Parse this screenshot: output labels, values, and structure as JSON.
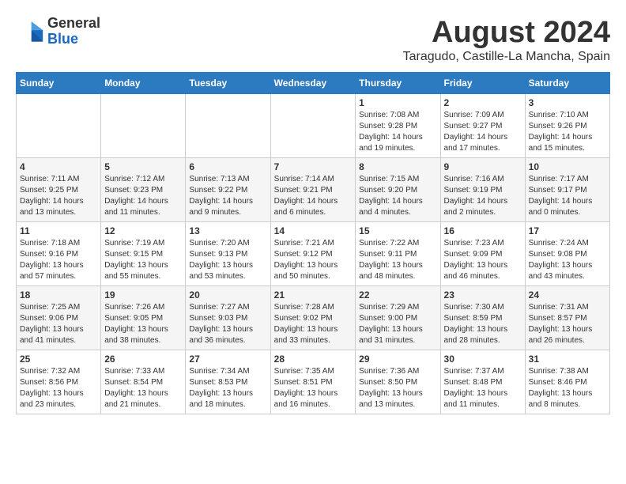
{
  "header": {
    "logo_general": "General",
    "logo_blue": "Blue",
    "main_title": "August 2024",
    "subtitle": "Taragudo, Castille-La Mancha, Spain"
  },
  "calendar": {
    "days_of_week": [
      "Sunday",
      "Monday",
      "Tuesday",
      "Wednesday",
      "Thursday",
      "Friday",
      "Saturday"
    ],
    "weeks": [
      [
        {
          "day": "",
          "info": ""
        },
        {
          "day": "",
          "info": ""
        },
        {
          "day": "",
          "info": ""
        },
        {
          "day": "",
          "info": ""
        },
        {
          "day": "1",
          "info": "Sunrise: 7:08 AM\nSunset: 9:28 PM\nDaylight: 14 hours\nand 19 minutes."
        },
        {
          "day": "2",
          "info": "Sunrise: 7:09 AM\nSunset: 9:27 PM\nDaylight: 14 hours\nand 17 minutes."
        },
        {
          "day": "3",
          "info": "Sunrise: 7:10 AM\nSunset: 9:26 PM\nDaylight: 14 hours\nand 15 minutes."
        }
      ],
      [
        {
          "day": "4",
          "info": "Sunrise: 7:11 AM\nSunset: 9:25 PM\nDaylight: 14 hours\nand 13 minutes."
        },
        {
          "day": "5",
          "info": "Sunrise: 7:12 AM\nSunset: 9:23 PM\nDaylight: 14 hours\nand 11 minutes."
        },
        {
          "day": "6",
          "info": "Sunrise: 7:13 AM\nSunset: 9:22 PM\nDaylight: 14 hours\nand 9 minutes."
        },
        {
          "day": "7",
          "info": "Sunrise: 7:14 AM\nSunset: 9:21 PM\nDaylight: 14 hours\nand 6 minutes."
        },
        {
          "day": "8",
          "info": "Sunrise: 7:15 AM\nSunset: 9:20 PM\nDaylight: 14 hours\nand 4 minutes."
        },
        {
          "day": "9",
          "info": "Sunrise: 7:16 AM\nSunset: 9:19 PM\nDaylight: 14 hours\nand 2 minutes."
        },
        {
          "day": "10",
          "info": "Sunrise: 7:17 AM\nSunset: 9:17 PM\nDaylight: 14 hours\nand 0 minutes."
        }
      ],
      [
        {
          "day": "11",
          "info": "Sunrise: 7:18 AM\nSunset: 9:16 PM\nDaylight: 13 hours\nand 57 minutes."
        },
        {
          "day": "12",
          "info": "Sunrise: 7:19 AM\nSunset: 9:15 PM\nDaylight: 13 hours\nand 55 minutes."
        },
        {
          "day": "13",
          "info": "Sunrise: 7:20 AM\nSunset: 9:13 PM\nDaylight: 13 hours\nand 53 minutes."
        },
        {
          "day": "14",
          "info": "Sunrise: 7:21 AM\nSunset: 9:12 PM\nDaylight: 13 hours\nand 50 minutes."
        },
        {
          "day": "15",
          "info": "Sunrise: 7:22 AM\nSunset: 9:11 PM\nDaylight: 13 hours\nand 48 minutes."
        },
        {
          "day": "16",
          "info": "Sunrise: 7:23 AM\nSunset: 9:09 PM\nDaylight: 13 hours\nand 46 minutes."
        },
        {
          "day": "17",
          "info": "Sunrise: 7:24 AM\nSunset: 9:08 PM\nDaylight: 13 hours\nand 43 minutes."
        }
      ],
      [
        {
          "day": "18",
          "info": "Sunrise: 7:25 AM\nSunset: 9:06 PM\nDaylight: 13 hours\nand 41 minutes."
        },
        {
          "day": "19",
          "info": "Sunrise: 7:26 AM\nSunset: 9:05 PM\nDaylight: 13 hours\nand 38 minutes."
        },
        {
          "day": "20",
          "info": "Sunrise: 7:27 AM\nSunset: 9:03 PM\nDaylight: 13 hours\nand 36 minutes."
        },
        {
          "day": "21",
          "info": "Sunrise: 7:28 AM\nSunset: 9:02 PM\nDaylight: 13 hours\nand 33 minutes."
        },
        {
          "day": "22",
          "info": "Sunrise: 7:29 AM\nSunset: 9:00 PM\nDaylight: 13 hours\nand 31 minutes."
        },
        {
          "day": "23",
          "info": "Sunrise: 7:30 AM\nSunset: 8:59 PM\nDaylight: 13 hours\nand 28 minutes."
        },
        {
          "day": "24",
          "info": "Sunrise: 7:31 AM\nSunset: 8:57 PM\nDaylight: 13 hours\nand 26 minutes."
        }
      ],
      [
        {
          "day": "25",
          "info": "Sunrise: 7:32 AM\nSunset: 8:56 PM\nDaylight: 13 hours\nand 23 minutes."
        },
        {
          "day": "26",
          "info": "Sunrise: 7:33 AM\nSunset: 8:54 PM\nDaylight: 13 hours\nand 21 minutes."
        },
        {
          "day": "27",
          "info": "Sunrise: 7:34 AM\nSunset: 8:53 PM\nDaylight: 13 hours\nand 18 minutes."
        },
        {
          "day": "28",
          "info": "Sunrise: 7:35 AM\nSunset: 8:51 PM\nDaylight: 13 hours\nand 16 minutes."
        },
        {
          "day": "29",
          "info": "Sunrise: 7:36 AM\nSunset: 8:50 PM\nDaylight: 13 hours\nand 13 minutes."
        },
        {
          "day": "30",
          "info": "Sunrise: 7:37 AM\nSunset: 8:48 PM\nDaylight: 13 hours\nand 11 minutes."
        },
        {
          "day": "31",
          "info": "Sunrise: 7:38 AM\nSunset: 8:46 PM\nDaylight: 13 hours\nand 8 minutes."
        }
      ]
    ]
  }
}
